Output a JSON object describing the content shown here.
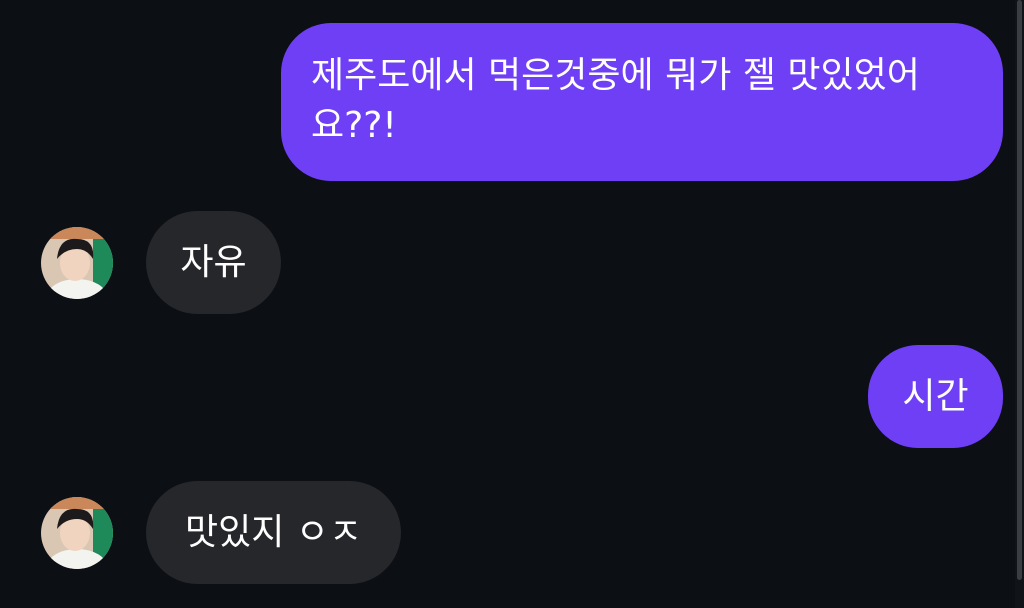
{
  "conversation": {
    "messages": [
      {
        "sender": "me",
        "text": "제주도에서 먹은것중에 뭐가 젤 맛있었어요??!"
      },
      {
        "sender": "them",
        "text": "자유"
      },
      {
        "sender": "me",
        "text": "시간"
      },
      {
        "sender": "them",
        "text": "맛있지 ㅇㅈ"
      }
    ]
  },
  "colors": {
    "background": "#0c0f14",
    "outgoing_bubble": "#6f3ff6",
    "incoming_bubble": "#25272b",
    "text": "#ffffff"
  },
  "icons": {
    "avatar": "avatar-photo"
  }
}
